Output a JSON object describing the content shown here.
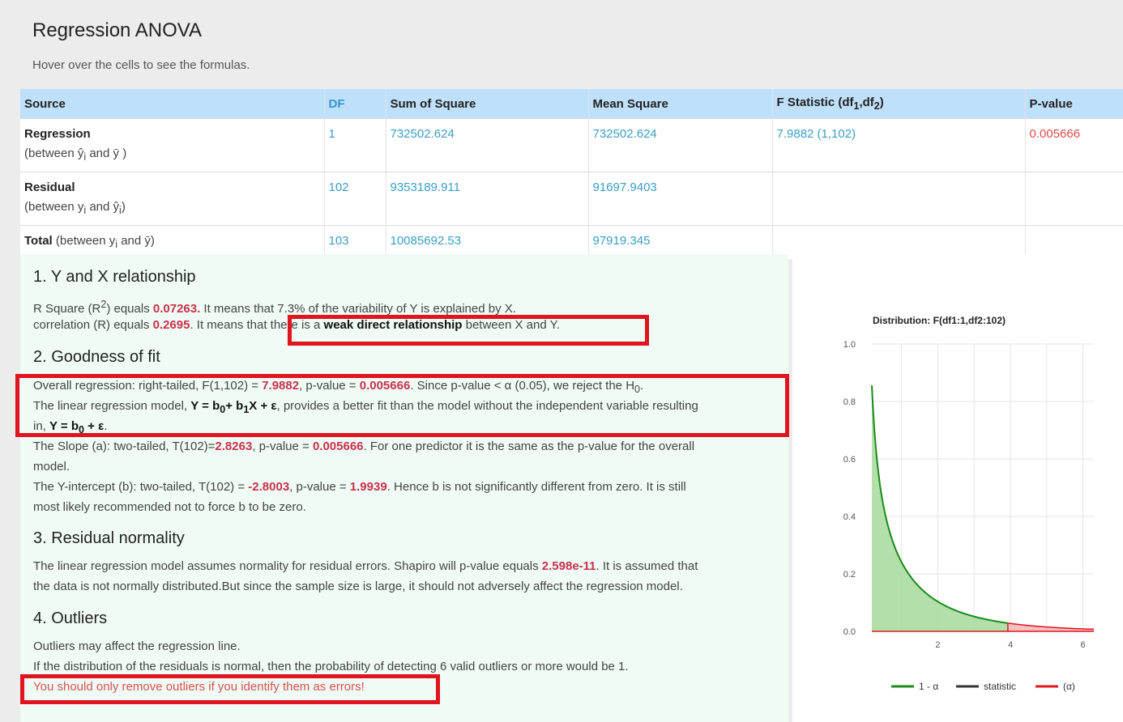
{
  "page": {
    "title": "Regression ANOVA",
    "subtitle": "Hover over the cells to see the formulas."
  },
  "table": {
    "headers": {
      "source": "Source",
      "df": "DF",
      "ss": "Sum of Square",
      "ms": "Mean Square",
      "f_pre": "F Statistic (df",
      "f_sub1": "1",
      "f_mid": ",df",
      "f_sub2": "2",
      "f_post": ")",
      "pv": "P-value"
    },
    "regression": {
      "name": "Regression",
      "sub_pre": "(between ",
      "sub_a": "ŷ",
      "sub_a_i": "i",
      "sub_mid": " and ",
      "sub_b": "ȳ",
      "sub_post": " )",
      "df": "1",
      "ss": "732502.624",
      "ms": "732502.624",
      "f": "7.9882 (1,102)",
      "pv": "0.005666"
    },
    "residual": {
      "name": "Residual",
      "sub_pre": "(between y",
      "sub_a_i": "i",
      "sub_mid": " and ",
      "sub_b": "ŷ",
      "sub_b_i": "i",
      "sub_post": ")",
      "df": "102",
      "ss": "9353189.911",
      "ms": "91697.9403"
    },
    "total": {
      "name": "Total",
      "sub_pre": " (between y",
      "sub_a_i": "i",
      "sub_mid": " and ",
      "sub_b": "ȳ",
      "sub_post": ")",
      "df": "103",
      "ss": "10085692.53",
      "ms": "97919.345"
    }
  },
  "sections": {
    "s1": {
      "title": "1. Y and X relationship",
      "l1_a": "R Square (R",
      "l1_sup": "2",
      "l1_b": ") equals ",
      "l1_val": "0.07263.",
      "l1_c": " It means that 7.3% of the variability of Y is explained by X.",
      "l2_a": "correlation (R) equals ",
      "l2_val": "0.2695",
      "l2_b": ". It means that there is a ",
      "l2_bold": "weak direct relationship",
      "l2_c": " between X and Y."
    },
    "s2": {
      "title": "2. Goodness of fit",
      "l1_a": "Overall regression: right-tailed, F(1,102) = ",
      "l1_f": "7.9882",
      "l1_b": ", p-value = ",
      "l1_p": "0.005666",
      "l1_c": ". Since p-value < α (0.05), we reject the H",
      "l1_sub": "0",
      "l1_d": ".",
      "l2_a": "The linear regression model, ",
      "l2_m1": "Y = b",
      "l2_m1s": "0",
      "l2_m2": "+ b",
      "l2_m2s": "1",
      "l2_m3": "X + ε",
      "l2_b": ", provides a better fit than the model without the independent variable resulting",
      "l3_a": "in, ",
      "l3_m1": "Y = b",
      "l3_m1s": "0",
      "l3_m2": " + ε",
      "l3_b": ".",
      "l4_a": "The Slope (a): two-tailed, T(102)=",
      "l4_t": "2.8263",
      "l4_b": ", p-value = ",
      "l4_p": "0.005666",
      "l4_c": ". For one predictor it is the same as the p-value for the overall",
      "l5": "model.",
      "l6_a": "The Y-intercept (b): two-tailed, T(102) = ",
      "l6_t": "-2.8003",
      "l6_b": ", p-value = ",
      "l6_p": "1.9939",
      "l6_c": ". Hence b is not significantly different from zero. It is still",
      "l7": "most likely recommended not to force b to be zero."
    },
    "s3": {
      "title": "3. Residual normality",
      "l1_a": "The linear regression model assumes normality for residual errors. Shapiro will p-value equals ",
      "l1_val": "2.598e-11",
      "l1_b": ". It is assumed that",
      "l2": "the data is not normally distributed.But since the sample size is large, it should not adversely affect the regression model."
    },
    "s4": {
      "title": "4. Outliers",
      "l1": "Outliers may affect the regression line.",
      "l2": "If the distribution of the residuals is normal, then the probability of detecting 6 valid outliers or more would be 1.",
      "l3": "You should only remove outliers if you identify them as errors!"
    }
  },
  "colors": {
    "accept_fill": "#a6d99c",
    "accept_line": "#1a8a1a",
    "reject_fill": "#f6b6b6",
    "reject_line": "#e0151f",
    "highlight_box": "#e0151f"
  },
  "chart_data": {
    "type": "area",
    "title": "Distribution: F(df1:1,df2:102)",
    "distribution": "F",
    "df1": 1,
    "df2": 102,
    "xlim": [
      0.18,
      6.3
    ],
    "ylim": [
      0,
      1.0
    ],
    "x_ticks": [
      "2",
      "4",
      "6"
    ],
    "y_ticks": [
      "0.0",
      "0.2",
      "0.4",
      "0.6",
      "0.8",
      "1.0"
    ],
    "critical_value": 3.93,
    "statistic": 7.9882,
    "grid": true,
    "legend_position": "bottom",
    "series": [
      {
        "name": "1 - α",
        "color": "#1a8a1a"
      },
      {
        "name": "statistic",
        "color": "#333333"
      },
      {
        "name": "(α)",
        "color": "#e0151f"
      }
    ]
  }
}
